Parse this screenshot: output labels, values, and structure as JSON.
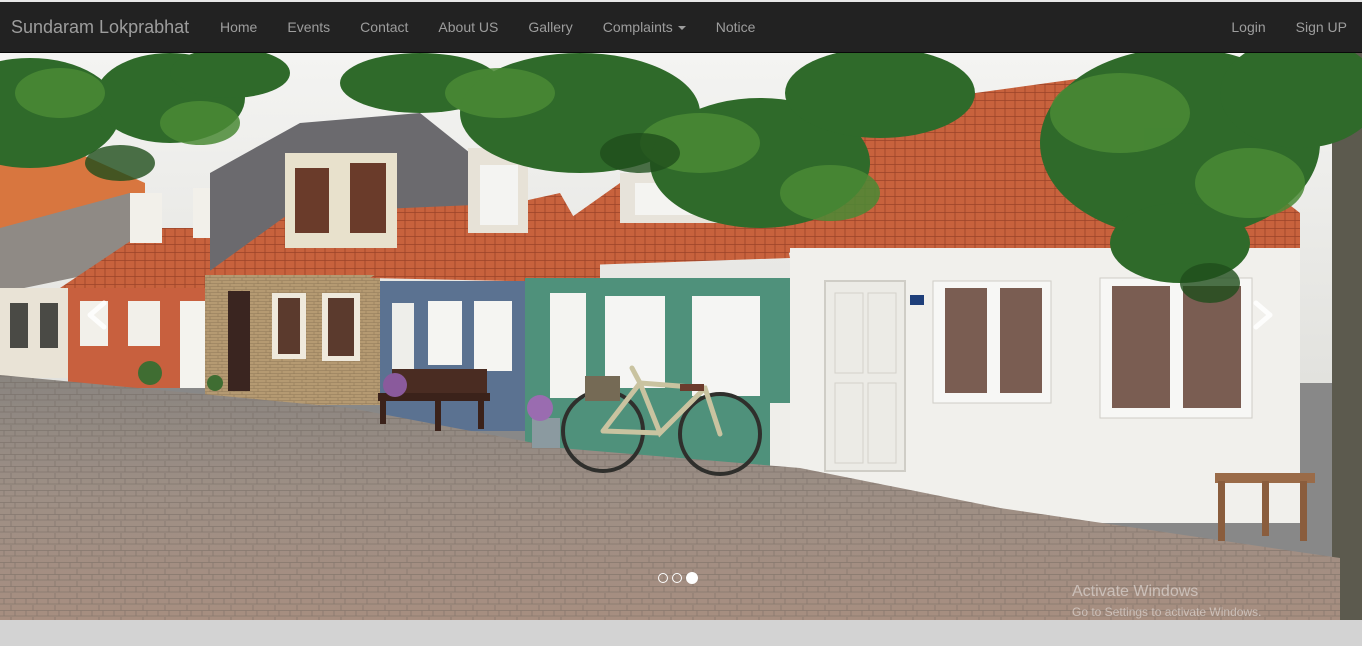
{
  "brand": "Sundaram Lokprabhat",
  "nav": {
    "home": "Home",
    "events": "Events",
    "contact": "Contact",
    "about": "About US",
    "gallery": "Gallery",
    "complaints": "Complaints",
    "notice": "Notice",
    "login": "Login",
    "signup": "Sign UP"
  },
  "carousel": {
    "slide_count": 3,
    "active_slide": 3,
    "prev_icon": "chevron-left-icon",
    "next_icon": "chevron-right-icon"
  },
  "watermark": {
    "line1": "Activate Windows",
    "line2": "Go to Settings to activate Windows."
  },
  "colors": {
    "navbar_bg": "#222222",
    "nav_text": "#9d9d9d",
    "page_bg": "#d3d3d3"
  }
}
